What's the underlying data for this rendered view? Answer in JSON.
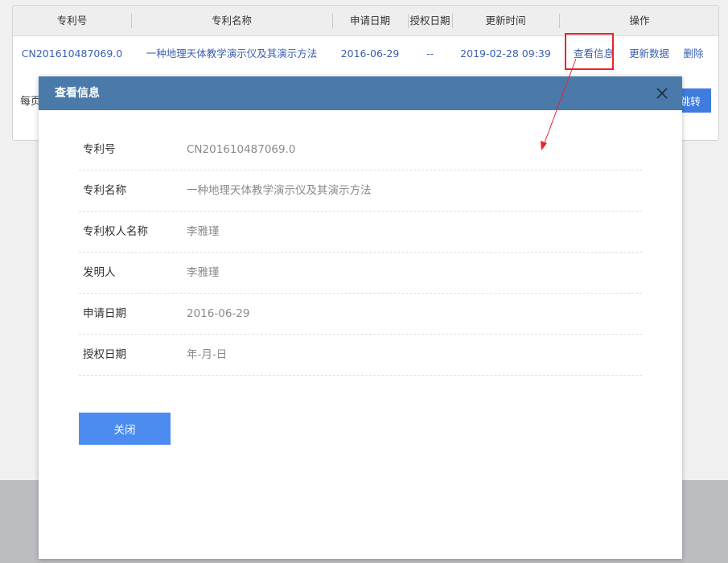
{
  "table": {
    "headers": {
      "patent_no": "专利号",
      "patent_name": "专利名称",
      "apply_date": "申请日期",
      "grant_date": "授权日期",
      "update_time": "更新时间",
      "actions": "操作"
    },
    "row": {
      "patent_no": "CN201610487069.0",
      "patent_name": "一种地理天体教学演示仪及其演示方法",
      "apply_date": "2016-06-29",
      "grant_date": "--",
      "update_time": "2019-02-28 09:39",
      "view_label": "查看信息",
      "update_label": "更新数据",
      "delete_label": "删除"
    }
  },
  "pager": {
    "per_page_label": "每页",
    "jump_label": "跳转"
  },
  "modal": {
    "title": "查看信息",
    "fields": [
      {
        "label": "专利号",
        "value": "CN201610487069.0"
      },
      {
        "label": "专利名称",
        "value": "一种地理天体教学演示仪及其演示方法"
      },
      {
        "label": "专利权人名称",
        "value": "李雅瑾"
      },
      {
        "label": "发明人",
        "value": "李雅瑾"
      },
      {
        "label": "申请日期",
        "value": "2016-06-29"
      },
      {
        "label": "授权日期",
        "value": "年-月-日"
      }
    ],
    "close_label": "关闭"
  },
  "icons": {
    "modal_close": "close-icon"
  },
  "colors": {
    "link": "#3a5fb0",
    "header_bar": "#4a7aaa",
    "primary_button": "#4c8cf0",
    "highlight": "#e8242a"
  }
}
